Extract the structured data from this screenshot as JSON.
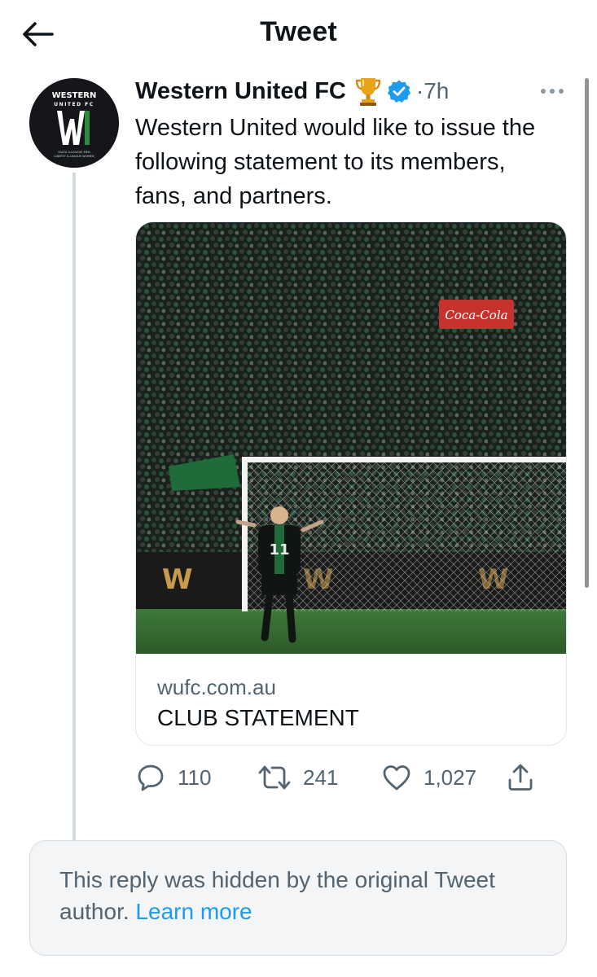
{
  "header": {
    "title": "Tweet",
    "back_icon": "arrow-left-icon"
  },
  "tweet": {
    "author_name": "Western United FC",
    "author_emoji": "trophy-icon",
    "verified_icon": "verified-badge-icon",
    "verified_color": "#1d9bf0",
    "separator": "·",
    "time": "7h",
    "text": "Western United would like to issue the following statement to its members, fans, and partners.",
    "avatar": {
      "line1": "WESTERN",
      "line2": "UNITED FC",
      "subline1": "ISUZU A-LEAGUE MEN",
      "subline2": "LIBERTY A-LEAGUE WOMEN"
    },
    "card": {
      "domain": "wufc.com.au",
      "title": "CLUB STATEMENT",
      "image_description_icon": "stadium-photo",
      "player_number": "11",
      "ad_text": "Coca-Cola"
    },
    "actions": {
      "replies": "110",
      "retweets": "241",
      "likes": "1,027"
    }
  },
  "hidden_reply": {
    "text": "This reply was hidden by the original Tweet author.",
    "link": "Learn more",
    "link_color": "#1d9bf0"
  },
  "colors": {
    "brand_green": "#2d8a3e",
    "muted_text": "#536471",
    "link_blue": "#1d9bf0"
  }
}
